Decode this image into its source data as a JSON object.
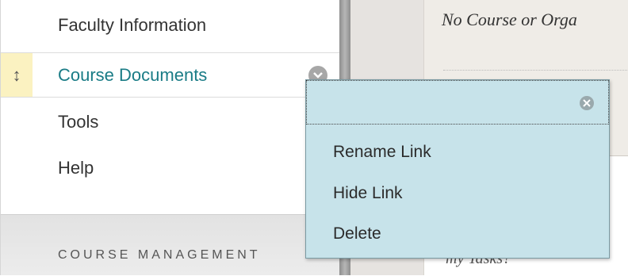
{
  "menu": {
    "items": [
      {
        "label": "Faculty Information"
      },
      {
        "label": "Course Documents"
      },
      {
        "label": "Tools"
      },
      {
        "label": "Help"
      }
    ],
    "section_header": "COURSE MANAGEMENT",
    "drag_icon": "↕",
    "accent_color": "#1a7c86"
  },
  "content": {
    "heading_text": "No Course or Orga",
    "footer_text": "my Tasks?"
  },
  "popup": {
    "items": [
      {
        "label": "Rename Link"
      },
      {
        "label": "Hide Link"
      },
      {
        "label": "Delete"
      }
    ],
    "close_icon": "close-icon",
    "background": "#c7e3ea"
  }
}
